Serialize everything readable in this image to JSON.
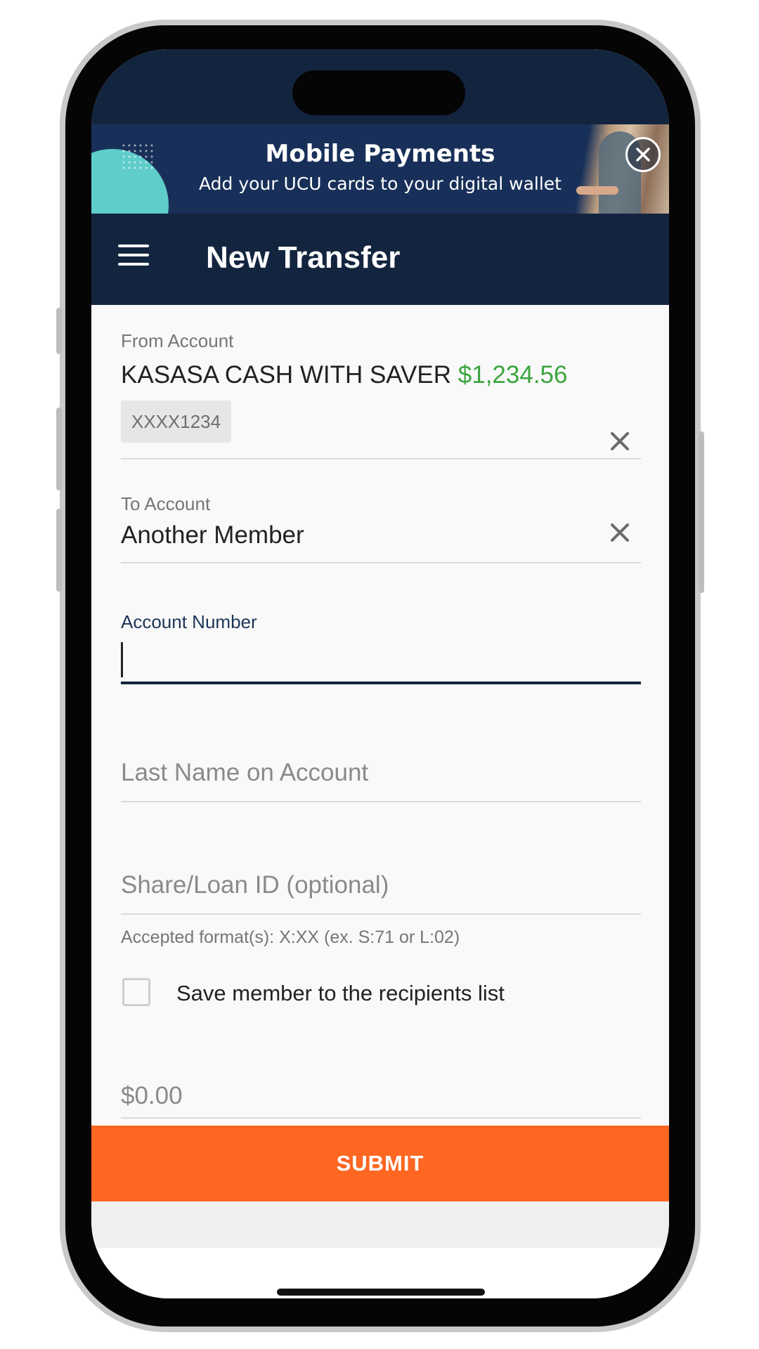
{
  "banner": {
    "title": "Mobile Payments",
    "subtitle": "Add your UCU cards to your digital wallet",
    "close_icon": "close-circle-icon"
  },
  "header": {
    "title": "New Transfer",
    "menu_icon": "hamburger-menu-icon"
  },
  "form": {
    "from_account": {
      "label": "From Account",
      "name": "KASASA CASH WITH SAVER",
      "balance": "$1,234.56",
      "masked_number": "XXXX1234"
    },
    "to_account": {
      "label": "To Account",
      "value": "Another Member"
    },
    "account_number": {
      "label": "Account Number",
      "value": ""
    },
    "last_name": {
      "placeholder": "Last Name on Account"
    },
    "share_loan_id": {
      "placeholder": "Share/Loan ID (optional)",
      "helper": "Accepted format(s): X:XX (ex. S:71 or L:02)"
    },
    "save_recipient": {
      "label": "Save member to the recipients list",
      "checked": false
    },
    "amount": {
      "placeholder": "$0.00"
    },
    "submit_label": "SUBMIT"
  },
  "colors": {
    "header_navy": "#13243f",
    "banner_navy": "#183059",
    "accent_teal": "#5fcdc9",
    "balance_green": "#3ba53e",
    "submit_orange": "#fd6722"
  }
}
